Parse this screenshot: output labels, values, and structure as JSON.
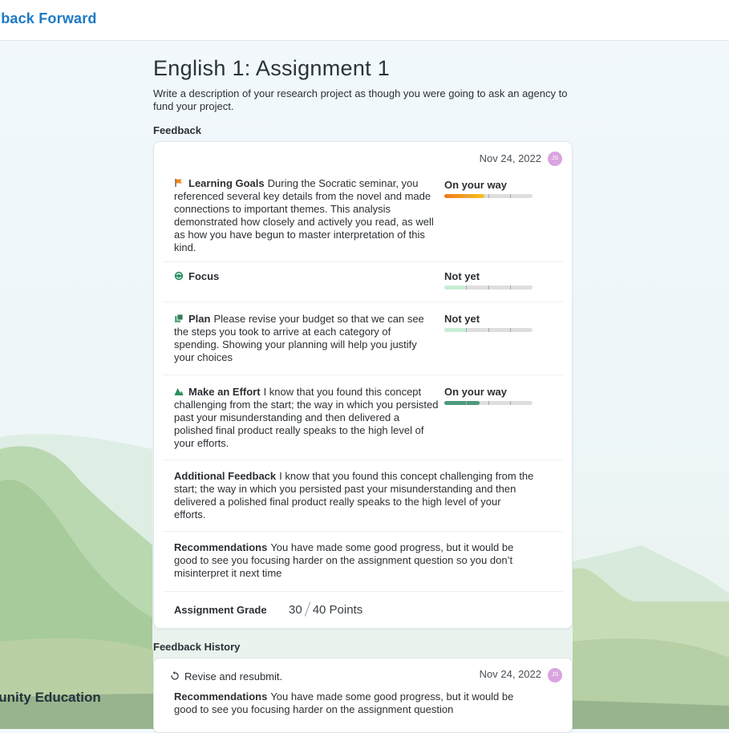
{
  "app": {
    "brand": "dback Forward",
    "footer_brand": "rtunity Education"
  },
  "assignment": {
    "title": "English 1: Assignment 1",
    "description": "Write a description of your research project as though you were going to ask an agency to fund your project."
  },
  "feedback": {
    "section_label": "Feedback",
    "date": "Nov 24, 2022",
    "avatar_initials": "JS",
    "items": [
      {
        "icon": "flag-icon",
        "label": "Learning Goals",
        "text": "During the Socratic seminar, you referenced several key details from the novel and made connections to important themes. This analysis demonstrated how closely and actively you read, as well as how you have begun to master interpretation of this kind.",
        "rating": "On your way",
        "level": 0.45,
        "color": "#f0b21b"
      },
      {
        "icon": "focus-icon",
        "label": "Focus",
        "text": "",
        "rating": "Not yet",
        "level": 0.25,
        "color": "#c9ecd3"
      },
      {
        "icon": "plan-icon",
        "label": "Plan",
        "text": "Please revise your budget so that we can see the steps you took to arrive at each category of spending. Showing your planning will help you justify your choices",
        "rating": "Not yet",
        "level": 0.25,
        "color": "#c9ecd3"
      },
      {
        "icon": "mountain-icon",
        "label": "Make an Effort",
        "text": "I know that you found this concept challenging from the start; the way in which you persisted past your misunderstanding and then delivered a polished final product really speaks to the high level of your efforts.",
        "rating": "On your way",
        "level": 0.4,
        "color": "#4c9b7c"
      }
    ],
    "additional": {
      "label": "Additional Feedback",
      "text": "I know that you found this concept challenging from the start; the way in which you persisted past your misunderstanding and then delivered a polished final product really speaks to the high level of your efforts."
    },
    "recommendations": {
      "label": "Recommendations",
      "text": "You have made some good progress, but it would be good to see you focusing harder on the assignment question so you don’t misinterpret it next time"
    },
    "grade": {
      "label": "Assignment Grade",
      "score": "30",
      "total": "40",
      "unit": "Points"
    }
  },
  "history": {
    "section_label": "Feedback History",
    "action": "Revise and resubmit.",
    "date": "Nov 24, 2022",
    "avatar_initials": "JS",
    "recommendations_label": "Recommendations",
    "recommendations_text": "You have made some good progress, but it would be good to see you focusing harder on the assignment question"
  },
  "colors": {
    "brand": "#1d7ac4",
    "goal_bar": "#f0b21b",
    "effort_bar": "#4c9b7c",
    "notyet_bar": "#c9ecd3"
  }
}
